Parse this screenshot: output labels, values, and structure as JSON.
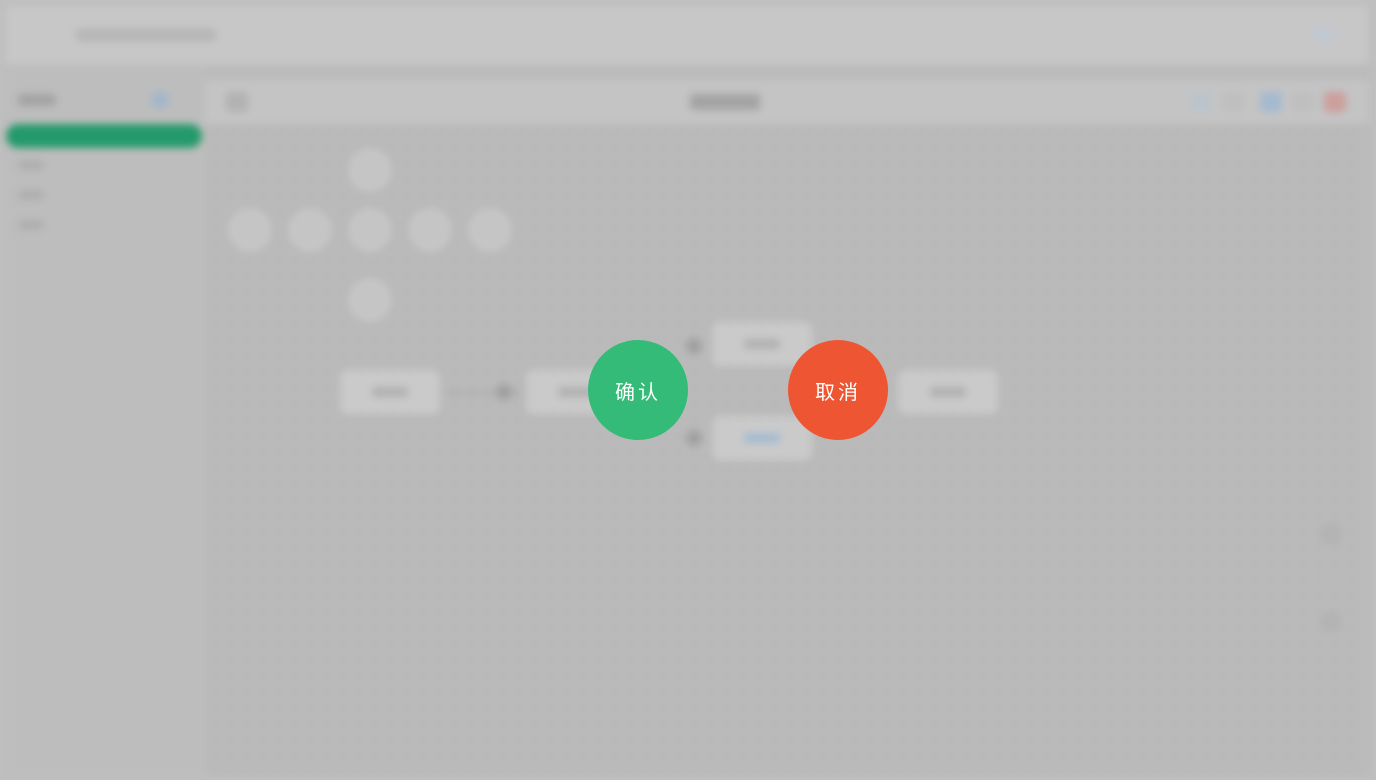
{
  "dialog": {
    "confirm_label": "确认",
    "cancel_label": "取消"
  },
  "colors": {
    "confirm": "#33bb77",
    "cancel": "#ee5533",
    "sidebar_active": "#1e9e6a"
  }
}
